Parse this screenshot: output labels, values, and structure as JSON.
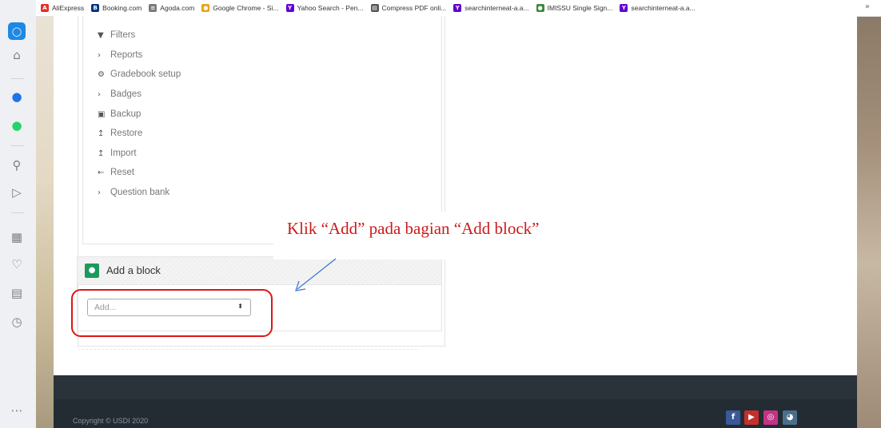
{
  "bookmarks": [
    {
      "label": "AliExpress",
      "color": "#e43225",
      "icon": "aliexpress-icon",
      "glyph": "A"
    },
    {
      "label": "Booking.com",
      "color": "#003580",
      "icon": "booking-icon",
      "glyph": "B"
    },
    {
      "label": "Agoda.com",
      "color": "#7a7a7a",
      "icon": "agoda-icon",
      "glyph": "≡"
    },
    {
      "label": "Google Chrome - Si...",
      "color": "#e8a317",
      "icon": "chrome-icon",
      "glyph": "●"
    },
    {
      "label": "Yahoo Search - Pen...",
      "color": "#6001d2",
      "icon": "yahoo-icon",
      "glyph": "Y"
    },
    {
      "label": "Compress PDF onli...",
      "color": "#555555",
      "icon": "document-icon",
      "glyph": "▤"
    },
    {
      "label": "searchinterneat-a.a...",
      "color": "#6001d2",
      "icon": "yahoo-icon",
      "glyph": "Y"
    },
    {
      "label": "IMISSU Single Sign...",
      "color": "#3a8a3a",
      "icon": "imissu-icon",
      "glyph": "●"
    },
    {
      "label": "searchinterneat-a.a...",
      "color": "#6001d2",
      "icon": "yahoo-icon",
      "glyph": "Y"
    }
  ],
  "bookmarks_more": "»",
  "admin_menu": [
    {
      "label": "Filters",
      "icon": "filter-icon",
      "glyph": "▼"
    },
    {
      "label": "Reports",
      "icon": "chevron-right-icon",
      "glyph": "›"
    },
    {
      "label": "Gradebook setup",
      "icon": "gear-icon",
      "glyph": "⚙"
    },
    {
      "label": "Badges",
      "icon": "chevron-right-icon",
      "glyph": "›"
    },
    {
      "label": "Backup",
      "icon": "backup-icon",
      "glyph": "▣"
    },
    {
      "label": "Restore",
      "icon": "restore-icon",
      "glyph": "↥"
    },
    {
      "label": "Import",
      "icon": "import-icon",
      "glyph": "↥"
    },
    {
      "label": "Reset",
      "icon": "arrow-left-icon",
      "glyph": "←"
    },
    {
      "label": "Question bank",
      "icon": "chevron-right-icon",
      "glyph": "›"
    }
  ],
  "add_block": {
    "title": "Add a block",
    "select_value": "Add...",
    "icon": "add-block-icon"
  },
  "annotation": {
    "text": "Klik “Add” pada bagian “Add block”",
    "color": "#cc1a1a"
  },
  "footer": {
    "copyright": "Copyright © USDI 2020",
    "social": [
      {
        "name": "facebook",
        "glyph": "f",
        "color": "#3b5998"
      },
      {
        "name": "youtube",
        "glyph": "▶",
        "color": "#c4302b"
      },
      {
        "name": "instagram",
        "glyph": "◎",
        "color": "#c13584"
      },
      {
        "name": "website",
        "glyph": "◕",
        "color": "#4a6f8a"
      }
    ]
  }
}
